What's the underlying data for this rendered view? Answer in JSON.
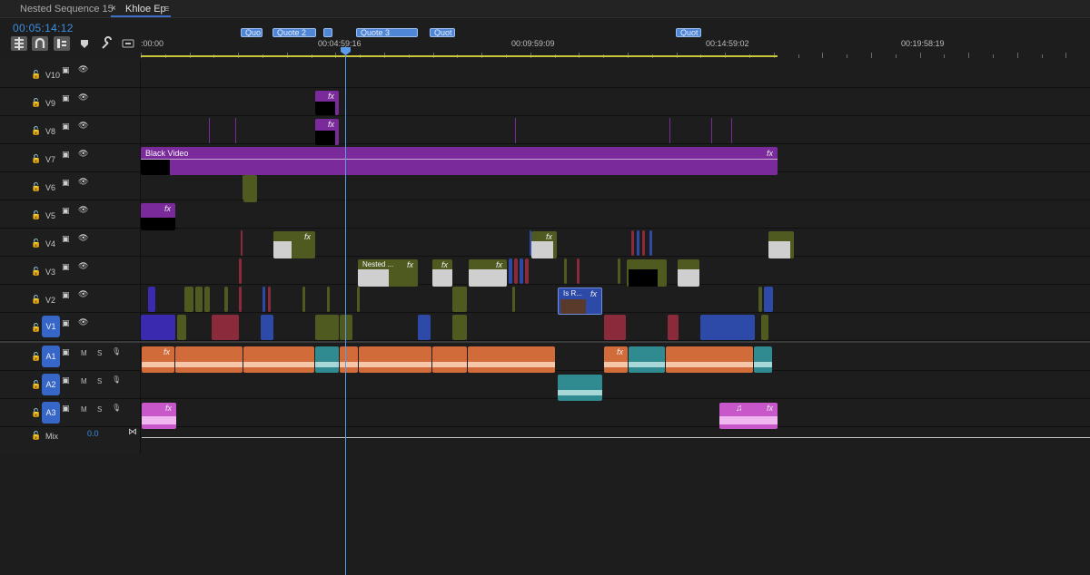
{
  "tabs": [
    {
      "label": "Nested Sequence 15"
    },
    {
      "label": "Khloe Ep",
      "close": "×",
      "menu": "≡"
    }
  ],
  "timecode": "00:05:14:12",
  "tools": [
    {
      "name": "insert-overwrite",
      "glyph": "⇟"
    },
    {
      "name": "snap",
      "glyph": "∩"
    },
    {
      "name": "linked-selection",
      "glyph": "⟂"
    },
    {
      "name": "add-marker",
      "glyph": "▾"
    },
    {
      "name": "settings",
      "glyph": "🔧"
    },
    {
      "name": "captions",
      "glyph": "▭"
    }
  ],
  "ruler": {
    "labels": [
      ":00:00",
      "00:04:59:16",
      "00:09:59:09",
      "00:14:59:02",
      "00:19:58:19"
    ],
    "markers": [
      "Quo",
      "Quote 2",
      "",
      "Quote 3",
      "Quot",
      "Quot"
    ]
  },
  "video_tracks": [
    "V10",
    "V9",
    "V8",
    "V7",
    "V6",
    "V5",
    "V4",
    "V3",
    "V2",
    "V1"
  ],
  "audio_tracks": [
    "A1",
    "A2",
    "A3"
  ],
  "audio_buttons": {
    "mute": "M",
    "solo": "S"
  },
  "mix": {
    "label": "Mix",
    "value": "0.0"
  },
  "clips": {
    "black_video": "Black Video",
    "nested": "Nested ...",
    "is_r": "Is R...",
    "fx": "fx"
  },
  "colors": {
    "purple": "#7a2a9a",
    "olive": "#4f5a21",
    "orange": "#d26b3a",
    "teal": "#2f8b8f",
    "pink": "#c857c9",
    "blue_select": "#3566c8",
    "playhead": "#5b9cea"
  }
}
